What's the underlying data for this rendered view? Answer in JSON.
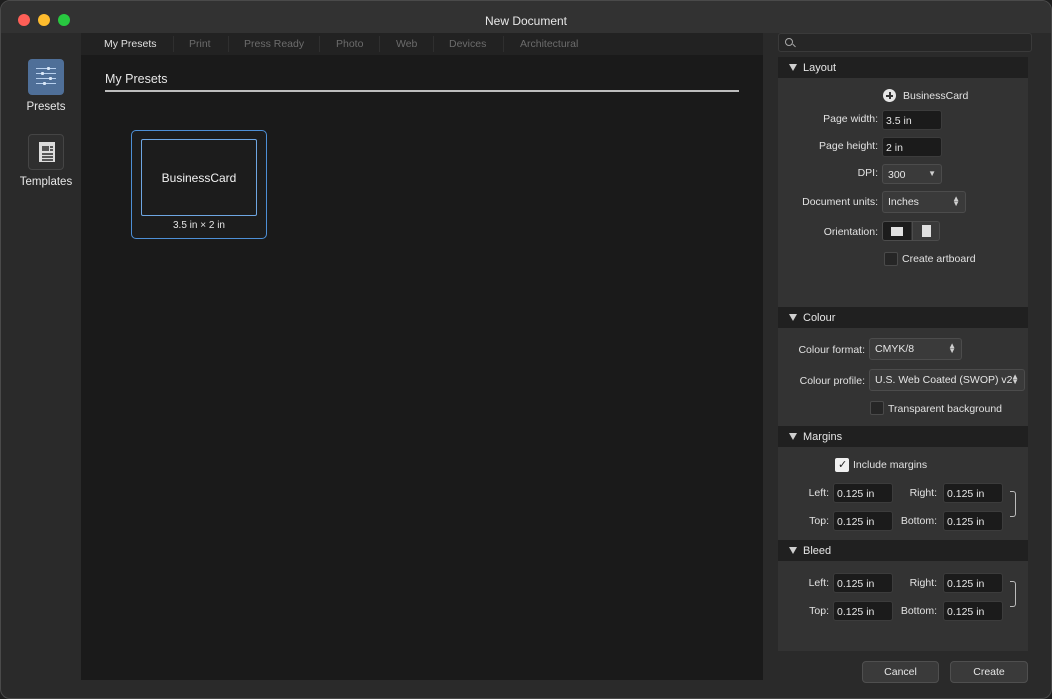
{
  "window": {
    "title": "New Document"
  },
  "sidebar": {
    "items": [
      {
        "label": "Presets",
        "icon": "presets-icon",
        "selected": true
      },
      {
        "label": "Templates",
        "icon": "templates-icon",
        "selected": false
      }
    ]
  },
  "tabs": [
    "My Presets",
    "Print",
    "Press Ready",
    "Photo",
    "Web",
    "Devices",
    "Architectural"
  ],
  "active_tab": "My Presets",
  "preset_section": {
    "title": "My Presets"
  },
  "presets": [
    {
      "name": "BusinessCard",
      "size": "3.5 in × 2 in",
      "selected": true
    }
  ],
  "search": {
    "placeholder": "",
    "icon": "search-icon"
  },
  "layout": {
    "header": "Layout",
    "preset_name": "BusinessCard",
    "page_width_label": "Page width:",
    "page_width": "3.5 in",
    "page_height_label": "Page height:",
    "page_height": "2 in",
    "dpi_label": "DPI:",
    "dpi": "300",
    "units_label": "Document units:",
    "units": "Inches",
    "orientation_label": "Orientation:",
    "orientation": "landscape",
    "artboard_label": "Create artboard",
    "artboard_checked": false
  },
  "colour": {
    "header": "Colour",
    "format_label": "Colour format:",
    "format": "CMYK/8",
    "profile_label": "Colour profile:",
    "profile": "U.S. Web Coated (SWOP) v2",
    "transparent_label": "Transparent background",
    "transparent_checked": false
  },
  "margins": {
    "header": "Margins",
    "include_label": "Include margins",
    "include_checked": true,
    "left_label": "Left:",
    "left": "0.125 in",
    "right_label": "Right:",
    "right": "0.125 in",
    "top_label": "Top:",
    "top": "0.125 in",
    "bottom_label": "Bottom:",
    "bottom": "0.125 in"
  },
  "bleed": {
    "header": "Bleed",
    "left_label": "Left:",
    "left": "0.125 in",
    "right_label": "Right:",
    "right": "0.125 in",
    "top_label": "Top:",
    "top": "0.125 in",
    "bottom_label": "Bottom:",
    "bottom": "0.125 in"
  },
  "footer": {
    "cancel_label": "Cancel",
    "create_label": "Create"
  },
  "colors": {
    "accent": "#4d8fd6",
    "window_bg": "#2a2a2a",
    "panel_bg": "#333333",
    "canvas_bg": "#1a1a1a"
  }
}
